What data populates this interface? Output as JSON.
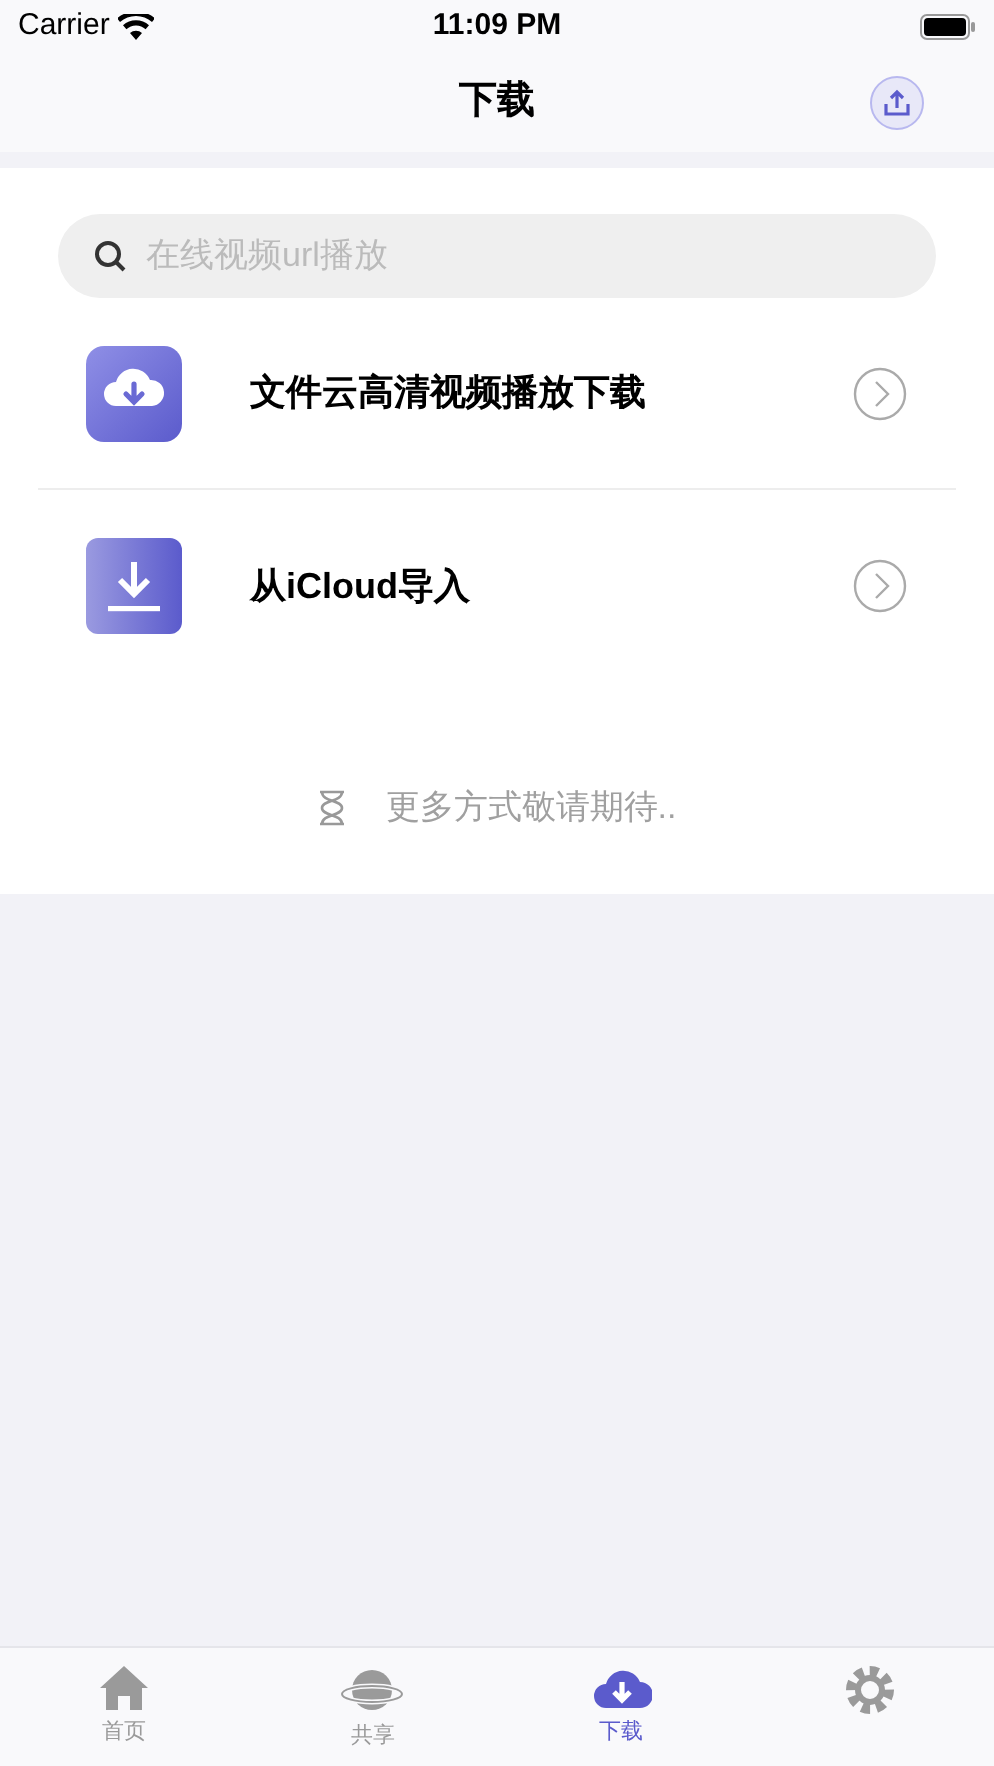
{
  "status_bar": {
    "carrier": "Carrier",
    "time": "11:09 PM"
  },
  "nav": {
    "title": "下载"
  },
  "search": {
    "placeholder": "在线视频url播放"
  },
  "items": [
    {
      "kind": "cloud",
      "label": "文件云高清视频播放下载"
    },
    {
      "kind": "download",
      "label": "从iCloud导入"
    }
  ],
  "footer_note": "更多方式敬请期待..",
  "tabs": [
    {
      "kind": "home",
      "label": "首页",
      "selected": false
    },
    {
      "kind": "planet",
      "label": "共享",
      "selected": false
    },
    {
      "kind": "cloud",
      "label": "下载",
      "selected": true
    },
    {
      "kind": "gear",
      "selected": false
    }
  ]
}
